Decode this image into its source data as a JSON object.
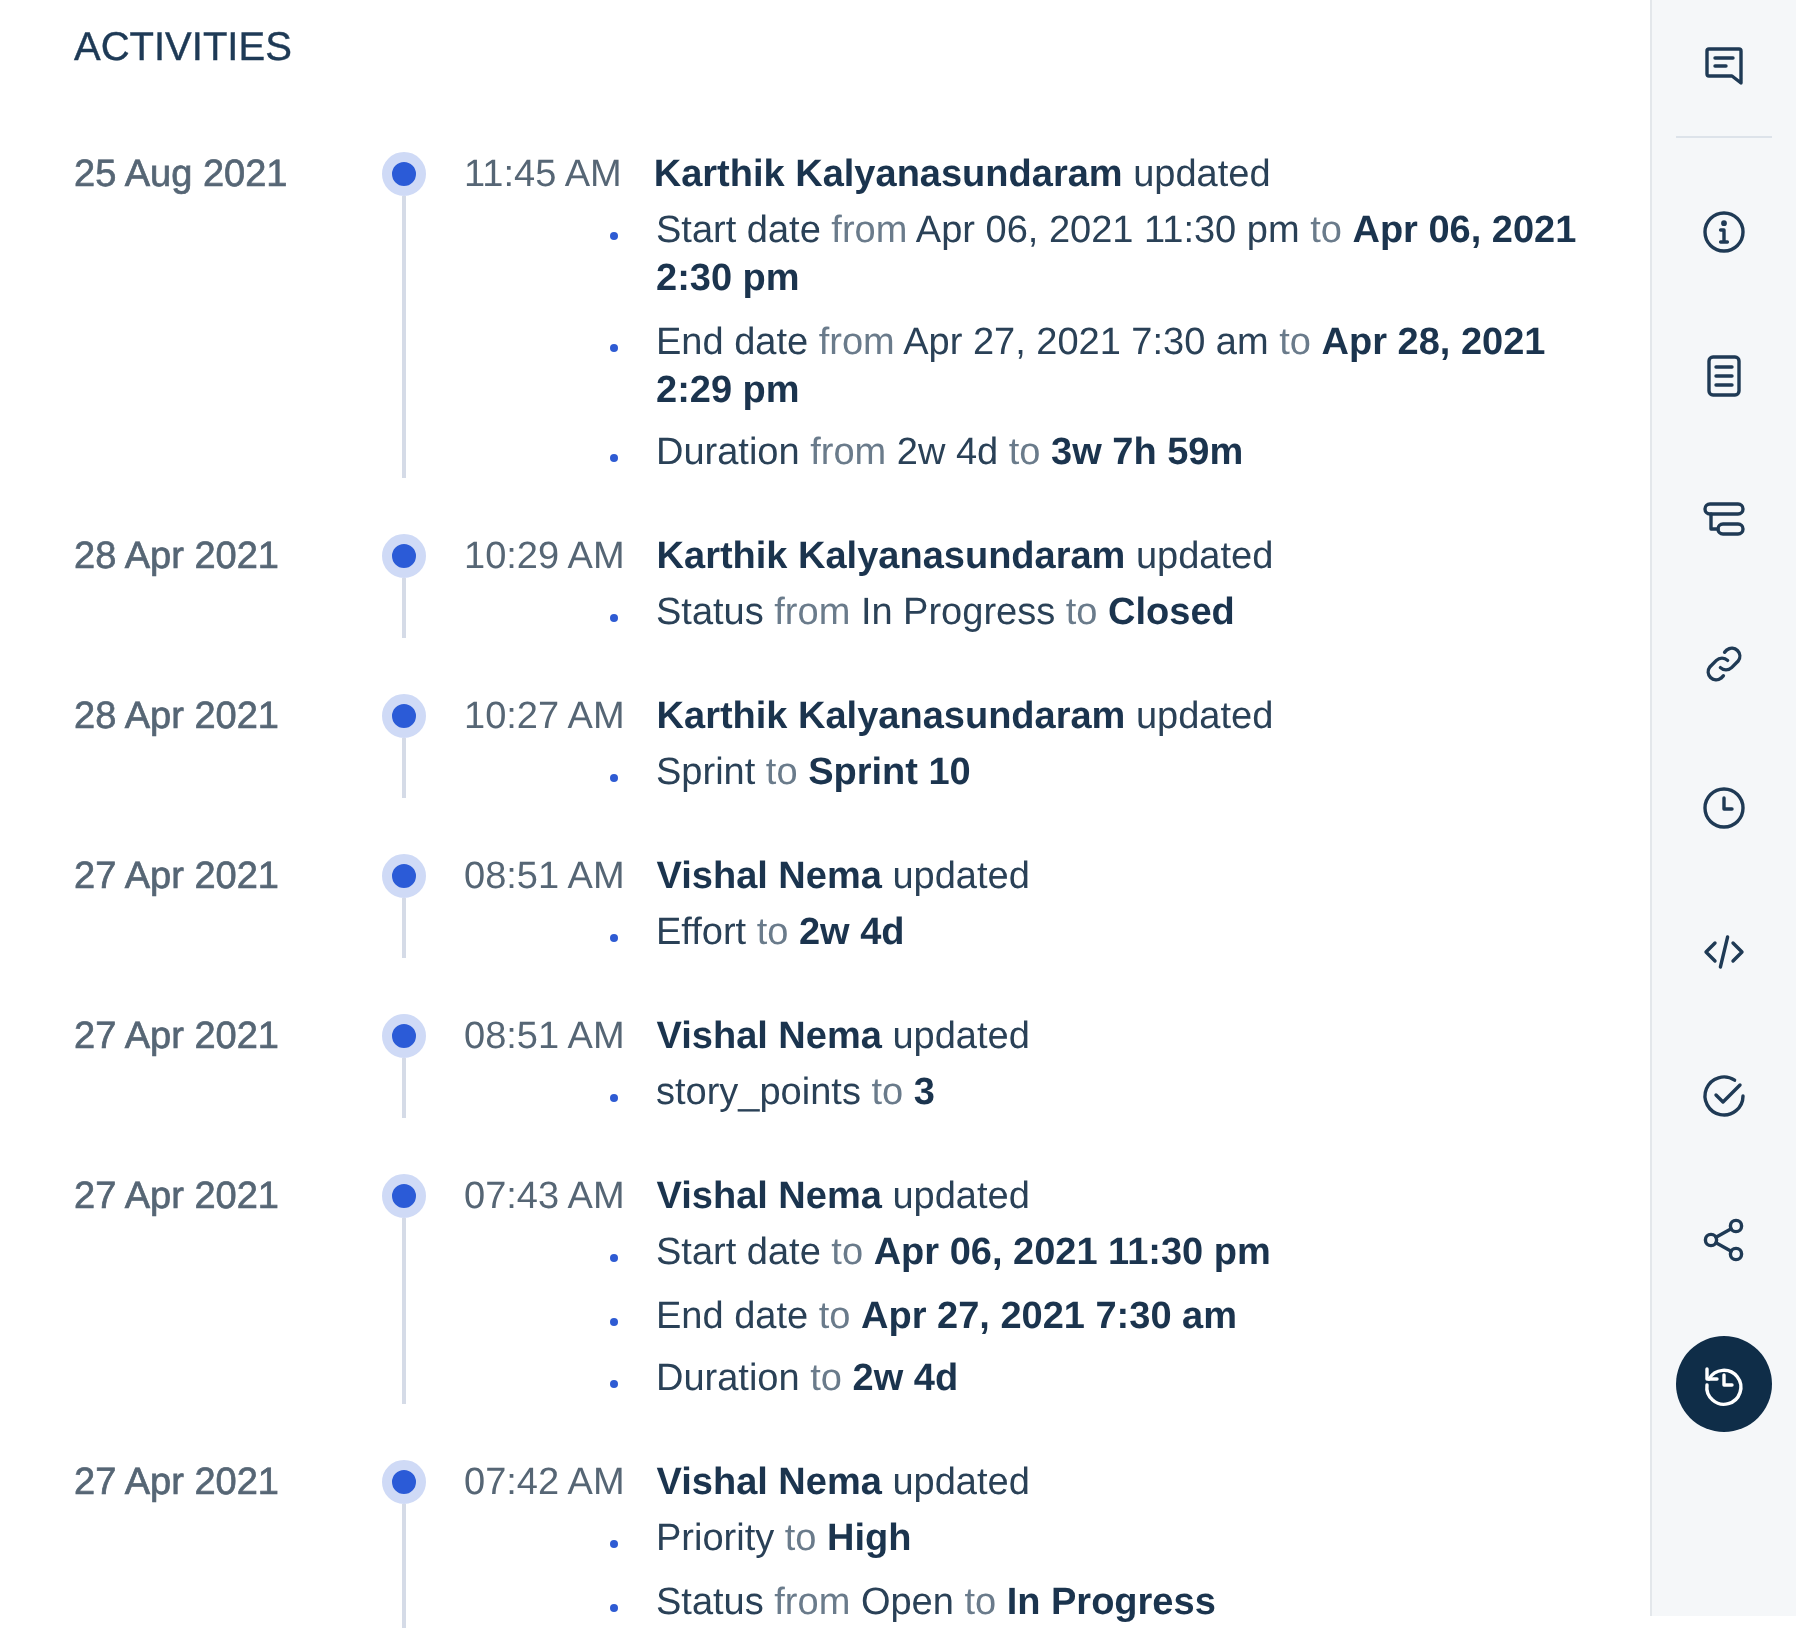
{
  "panel": {
    "title": "ACTIVITIES"
  },
  "activities": [
    {
      "date": "25 Aug 2021",
      "time": "11:45 AM",
      "user": "Karthik Kalyanasundaram",
      "action": "updated",
      "changes": [
        {
          "field": "Start date",
          "from_word": "from",
          "old_value": "Apr 06, 2021 11:30 pm",
          "to_word": "to",
          "new_value": "Apr 06, 2021 2:30 pm"
        },
        {
          "field": "End date",
          "from_word": "from",
          "old_value": "Apr 27, 2021 7:30 am",
          "to_word": "to",
          "new_value": "Apr 28, 2021 2:29 pm"
        },
        {
          "field": "Duration",
          "from_word": "from",
          "old_value": "2w 4d",
          "to_word": "to",
          "new_value": "3w 7h 59m"
        }
      ]
    },
    {
      "date": "28 Apr 2021",
      "time": "10:29 AM",
      "user": "Karthik Kalyanasundaram",
      "action": "updated",
      "changes": [
        {
          "field": "Status",
          "from_word": "from",
          "old_value": "In Progress",
          "to_word": "to",
          "new_value": "Closed"
        }
      ]
    },
    {
      "date": "28 Apr 2021",
      "time": "10:27 AM",
      "user": "Karthik Kalyanasundaram",
      "action": "updated",
      "changes": [
        {
          "field": "Sprint",
          "to_word": "to",
          "new_value": "Sprint 10"
        }
      ]
    },
    {
      "date": "27 Apr 2021",
      "time": "08:51 AM",
      "user": "Vishal Nema",
      "action": "updated",
      "changes": [
        {
          "field": "Effort",
          "to_word": "to",
          "new_value": "2w 4d"
        }
      ]
    },
    {
      "date": "27 Apr 2021",
      "time": "08:51 AM",
      "user": "Vishal Nema",
      "action": "updated",
      "changes": [
        {
          "field": "story_points",
          "to_word": "to",
          "new_value": "3"
        }
      ]
    },
    {
      "date": "27 Apr 2021",
      "time": "07:43 AM",
      "user": "Vishal Nema",
      "action": "updated",
      "changes": [
        {
          "field": "Start date",
          "to_word": "to",
          "new_value": "Apr 06, 2021 11:30 pm"
        },
        {
          "field": "End date",
          "to_word": "to",
          "new_value": "Apr 27, 2021 7:30 am"
        },
        {
          "field": "Duration",
          "to_word": "to",
          "new_value": "2w 4d"
        }
      ]
    },
    {
      "date": "27 Apr 2021",
      "time": "07:42 AM",
      "user": "Vishal Nema",
      "action": "updated",
      "changes": [
        {
          "field": "Priority",
          "to_word": "to",
          "new_value": "High"
        },
        {
          "field": "Status",
          "from_word": "from",
          "old_value": "Open",
          "to_word": "to",
          "new_value": "In Progress"
        }
      ]
    }
  ],
  "sidebar": {
    "top_items": [
      {
        "selected": false
      }
    ],
    "items": [
      {
        "selected": false
      },
      {
        "selected": false
      },
      {
        "selected": false
      },
      {
        "selected": false
      },
      {
        "selected": false
      },
      {
        "selected": false
      },
      {
        "selected": false
      },
      {
        "selected": false
      },
      {
        "selected": true
      }
    ]
  }
}
